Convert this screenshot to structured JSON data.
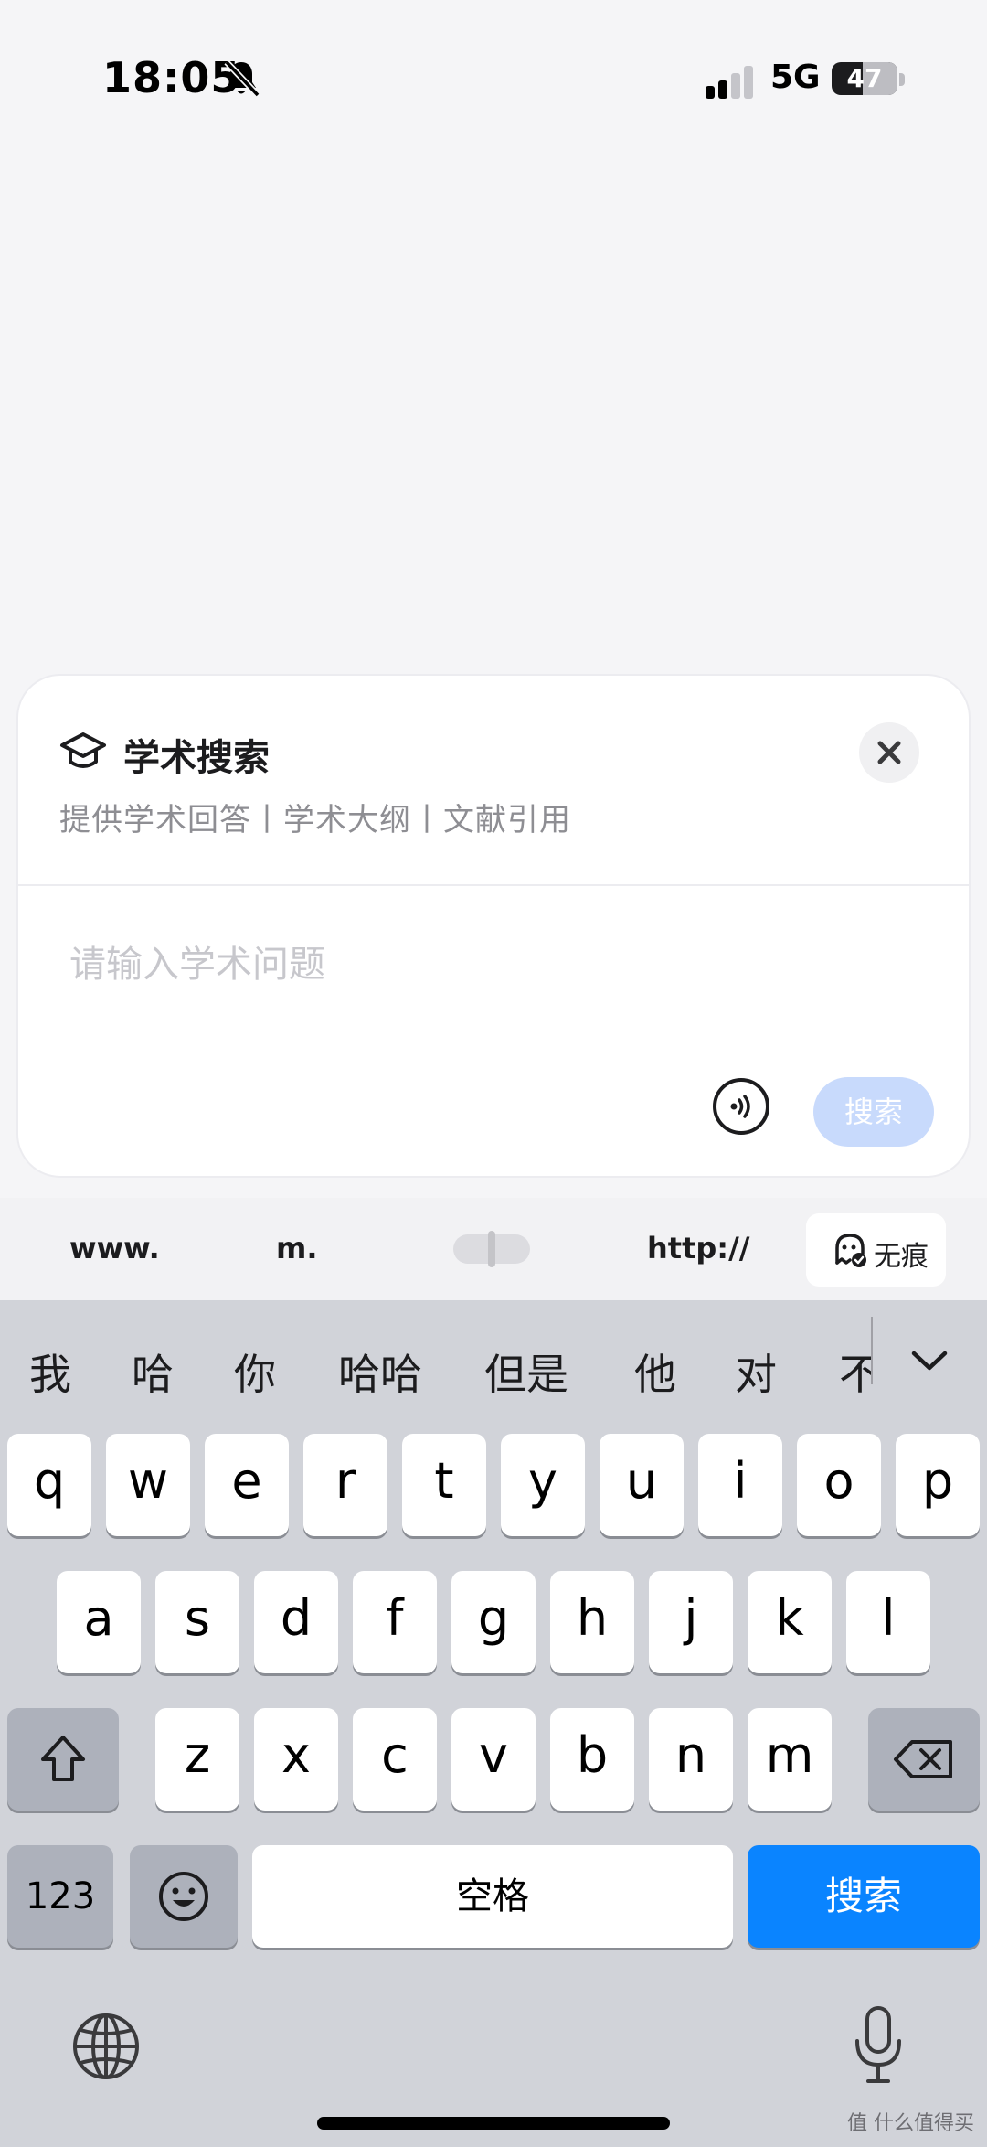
{
  "status_bar": {
    "time": "18:05",
    "network": "5G",
    "battery": "47",
    "battery_level": 0.47,
    "silent_icon": "bell-slash-icon",
    "signal_icon": "cellular-signal-icon"
  },
  "search_card": {
    "icon": "graduation-cap-icon",
    "title": "学术搜索",
    "subtitle": "提供学术回答丨学术大纲丨文献引用",
    "close_icon": "close-icon",
    "input_placeholder": "请输入学术问题",
    "voice_icon": "voice-wave-icon",
    "search_button": "搜索",
    "search_button_color": "#c8dafc"
  },
  "quick_strip": {
    "keys": [
      "www.",
      "m.",
      "http://"
    ],
    "incognito_label": "无痕",
    "incognito_icon": "incognito-ghost-icon"
  },
  "keyboard": {
    "candidates": [
      "我",
      "哈",
      "你",
      "哈哈",
      "但是",
      "他",
      "对",
      "不"
    ],
    "expand_icon": "chevron-down-icon",
    "rows": [
      [
        "q",
        "w",
        "e",
        "r",
        "t",
        "y",
        "u",
        "i",
        "o",
        "p"
      ],
      [
        "a",
        "s",
        "d",
        "f",
        "g",
        "h",
        "j",
        "k",
        "l"
      ],
      [
        "z",
        "x",
        "c",
        "v",
        "b",
        "n",
        "m"
      ]
    ],
    "shift_icon": "shift-icon",
    "delete_icon": "backspace-icon",
    "numbers_key": "123",
    "emoji_icon": "emoji-icon",
    "space_label": "空格",
    "return_label": "搜索",
    "return_color": "#0a84ff",
    "globe_icon": "globe-icon",
    "mic_icon": "microphone-icon"
  },
  "watermark": "值 什么值得买"
}
